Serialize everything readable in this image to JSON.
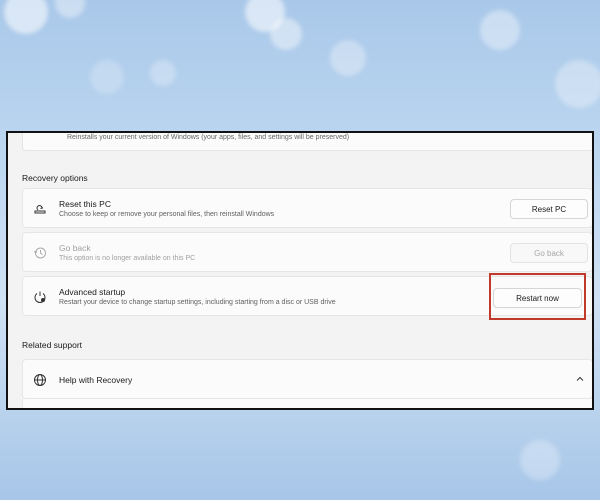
{
  "top_card": {
    "description": "Reinstalls your current version of Windows (your apps, files, and settings will be preserved)"
  },
  "recovery": {
    "heading": "Recovery options",
    "items": [
      {
        "title": "Reset this PC",
        "subtitle": "Choose to keep or remove your personal files, then reinstall Windows",
        "button": "Reset PC",
        "icon": "reset-pc-icon",
        "enabled": true
      },
      {
        "title": "Go back",
        "subtitle": "This option is no longer available on this PC",
        "button": "Go back",
        "icon": "history-icon",
        "enabled": false
      },
      {
        "title": "Advanced startup",
        "subtitle": "Restart your device to change startup settings, including starting from a disc or USB drive",
        "button": "Restart now",
        "icon": "advanced-startup-icon",
        "enabled": true
      }
    ]
  },
  "related": {
    "heading": "Related support",
    "help_item": {
      "title": "Help with Recovery",
      "icon": "globe-icon",
      "expanded": true
    }
  },
  "colors": {
    "highlight": "#c0392b",
    "disabled_text": "#a0a0a0"
  }
}
